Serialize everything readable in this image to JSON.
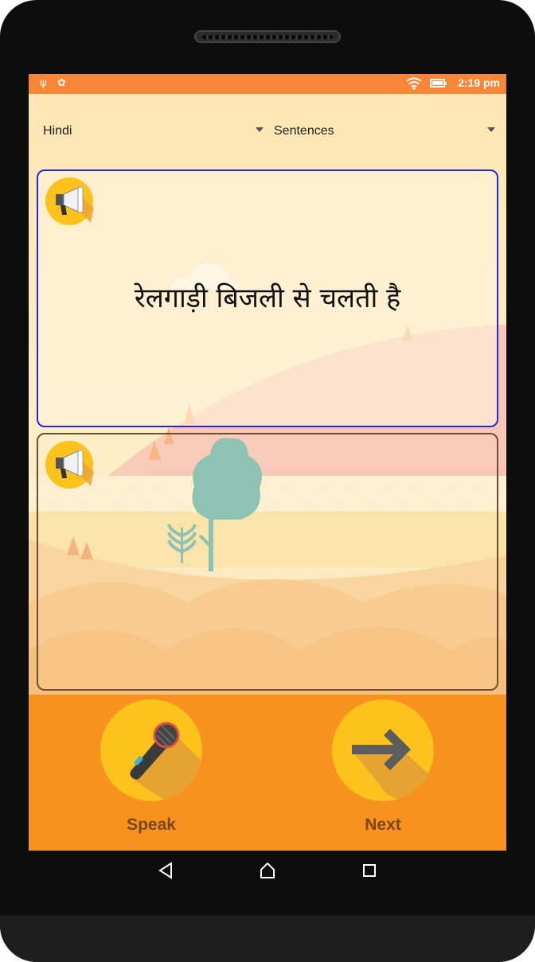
{
  "status_bar": {
    "time": "2:19 pm",
    "icons": [
      "usb-icon",
      "android-debug-icon",
      "wifi-icon",
      "battery-icon"
    ]
  },
  "language_select": {
    "selected": "Hindi"
  },
  "mode_select": {
    "selected": "Sentences"
  },
  "prompt_card": {
    "sentence": "रेलगाड़ी बिजली से चलती है",
    "icon": "megaphone-icon"
  },
  "response_card": {
    "text": "",
    "icon": "megaphone-icon"
  },
  "actions": {
    "speak_label": "Speak",
    "next_label": "Next"
  },
  "nav": {
    "icons": [
      "back-icon",
      "home-icon",
      "recents-icon"
    ]
  },
  "colors": {
    "status_bar": "#f98537",
    "accent_yellow": "#fdc21b",
    "top_card_border": "#2626e0",
    "bottom_card_border": "#6b4f35",
    "label_brown": "#7a461a"
  }
}
